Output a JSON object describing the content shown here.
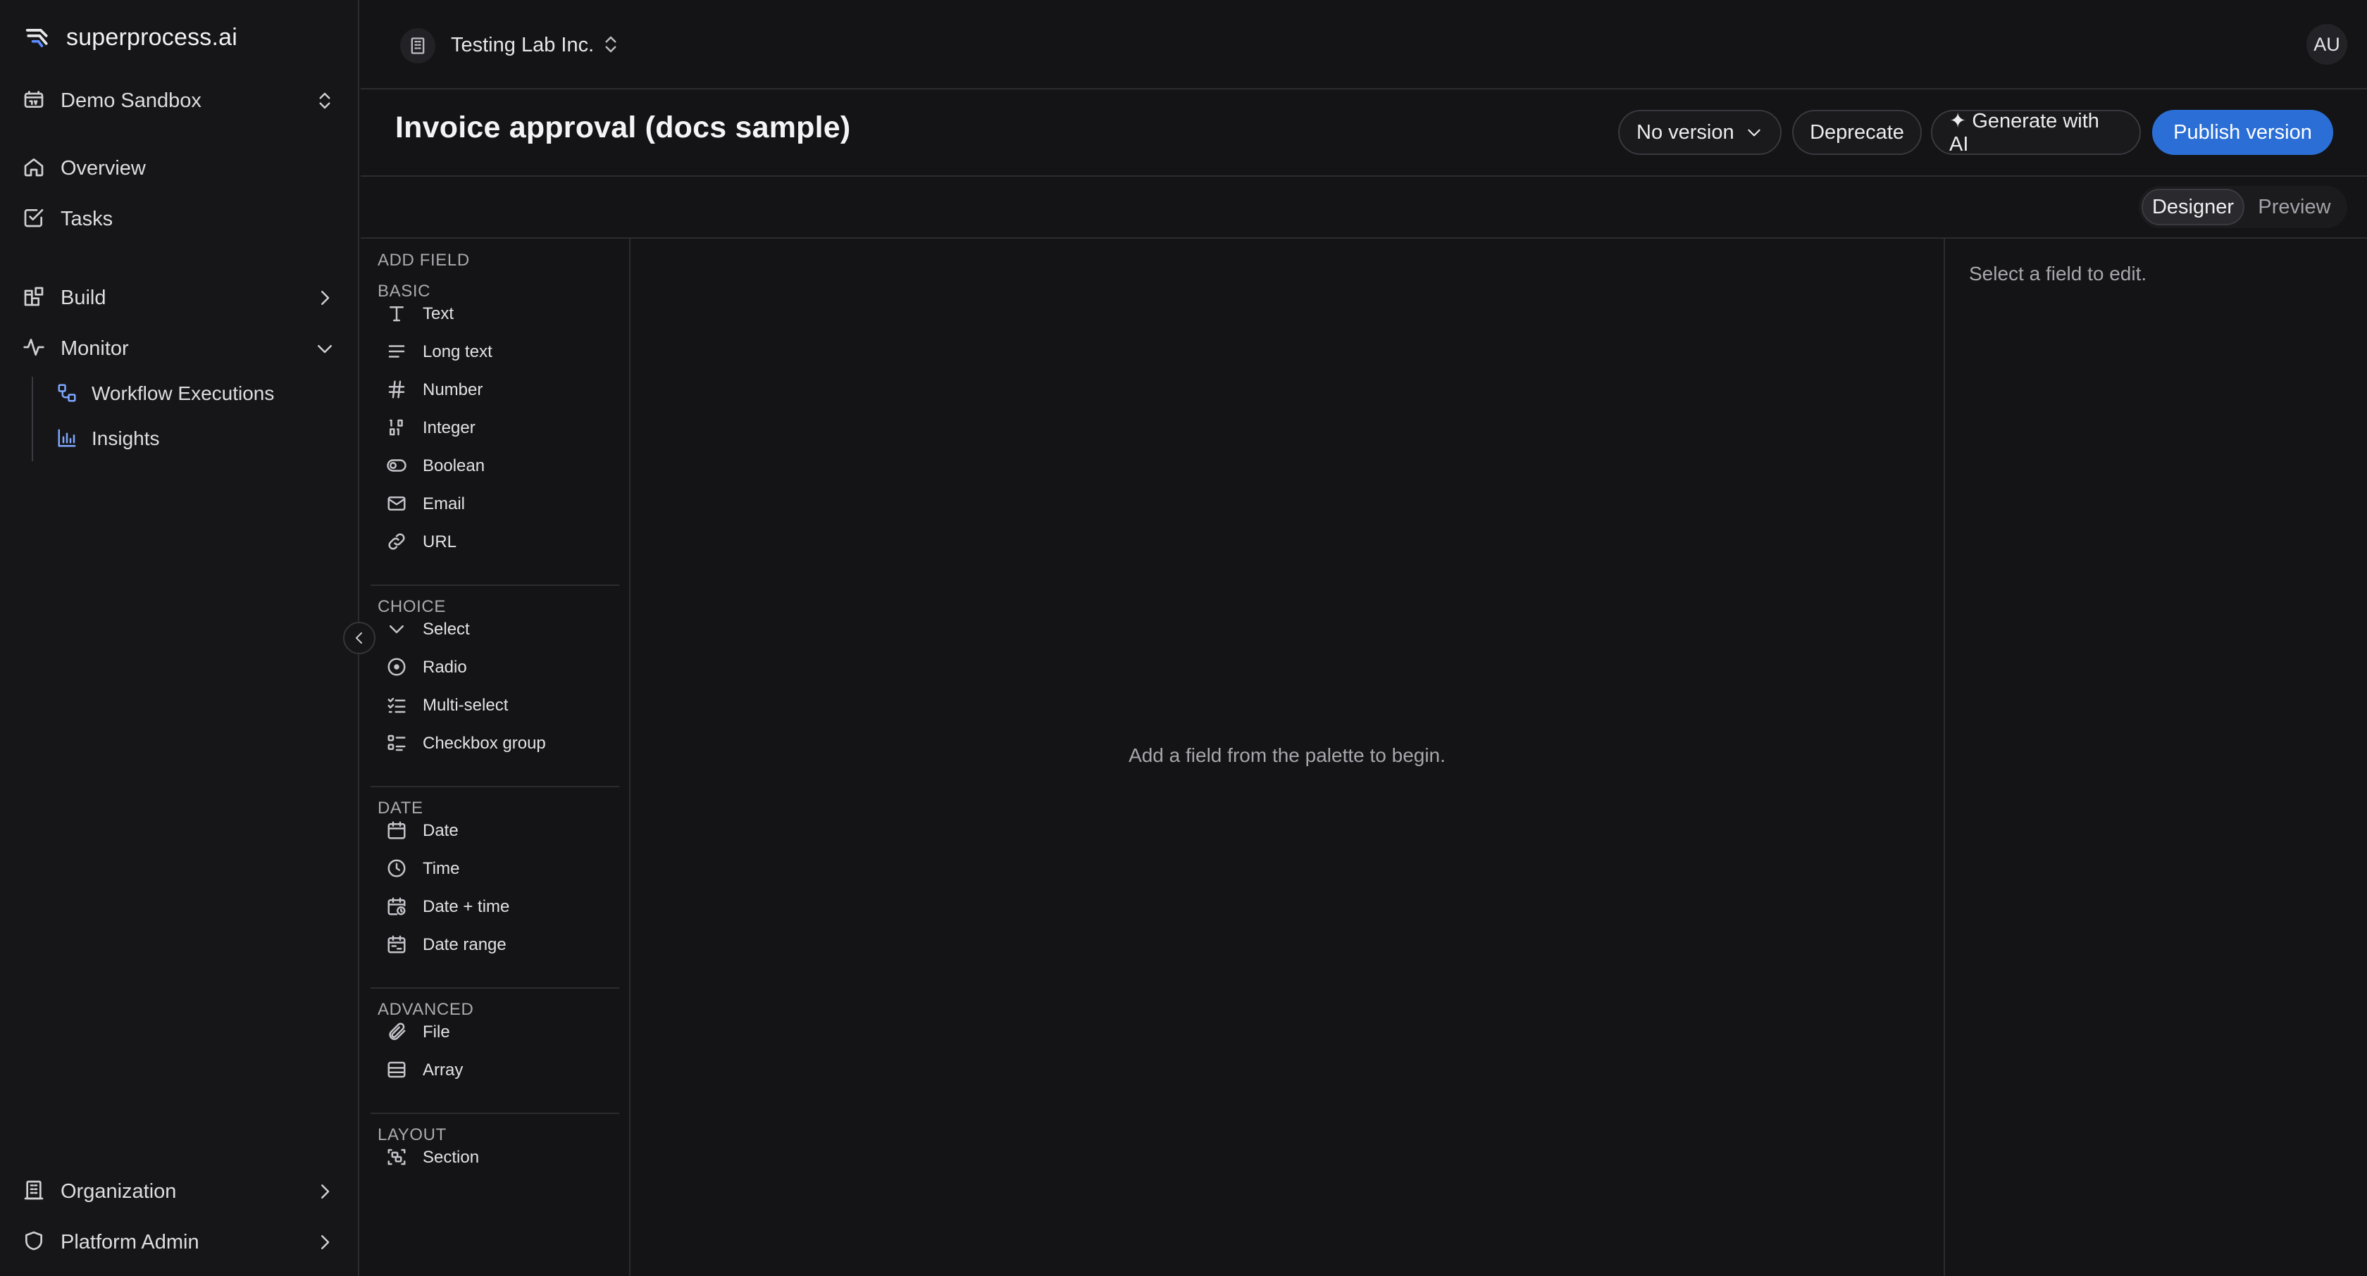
{
  "brand": {
    "name": "superprocess.ai",
    "logo_icon": "brand-logo-icon"
  },
  "workspace": {
    "name": "Demo Sandbox",
    "icon": "workspace-icon"
  },
  "sidebar": {
    "overview": "Overview",
    "tasks": "Tasks",
    "build": "Build",
    "monitor": "Monitor",
    "monitor_children": [
      "Workflow Executions",
      "Insights"
    ],
    "organization": "Organization",
    "platform_admin": "Platform Admin"
  },
  "topbar": {
    "org_name": "Testing Lab Inc.",
    "avatar_initials": "AU"
  },
  "titlebar": {
    "title": "Invoice approval (docs sample)",
    "version_select": "No version",
    "deprecate": "Deprecate",
    "generate": "✦ Generate with AI",
    "publish": "Publish version"
  },
  "modes": {
    "designer": "Designer",
    "preview": "Preview",
    "active": "Designer"
  },
  "palette": {
    "title": "ADD FIELD",
    "groups": [
      {
        "heading": "BASIC",
        "items": [
          "Text",
          "Long text",
          "Number",
          "Integer",
          "Boolean",
          "Email",
          "URL"
        ]
      },
      {
        "heading": "CHOICE",
        "items": [
          "Select",
          "Radio",
          "Multi-select",
          "Checkbox group"
        ]
      },
      {
        "heading": "DATE",
        "items": [
          "Date",
          "Time",
          "Date + time",
          "Date range"
        ]
      },
      {
        "heading": "ADVANCED",
        "items": [
          "File",
          "Array"
        ]
      },
      {
        "heading": "LAYOUT",
        "items": [
          "Section"
        ]
      }
    ]
  },
  "canvas": {
    "empty_message": "Add a field from the palette to begin."
  },
  "inspector": {
    "empty_message": "Select a field to edit."
  },
  "colors": {
    "background": "#141416",
    "primary": "#2b6fd6",
    "accent_icon": "#7ea7ff",
    "border": "#2c2c30"
  }
}
